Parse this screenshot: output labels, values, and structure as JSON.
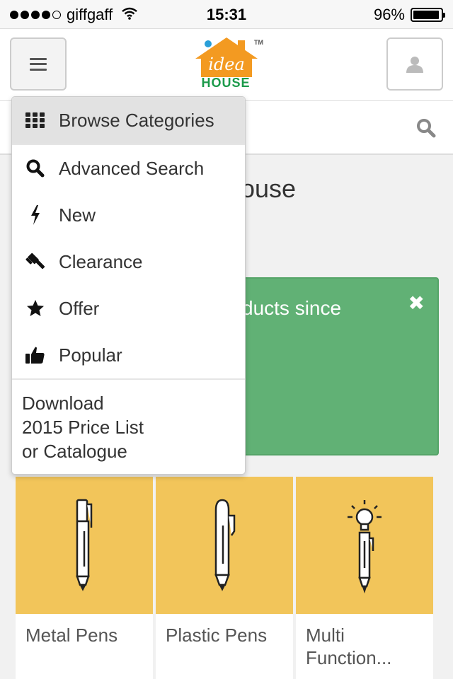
{
  "status_bar": {
    "carrier": "giffgaff",
    "time": "15:31",
    "battery_percent": "96%",
    "battery_level": 0.96
  },
  "header": {
    "logo_text": "HOUSE",
    "logo_script": "idea",
    "logo_tm": "TM",
    "menu_icon": "hamburger-icon",
    "user_icon": "user-icon"
  },
  "search": {
    "icon": "search-icon"
  },
  "page": {
    "title_partial": "ouse"
  },
  "notice": {
    "text_partial": "ducts since",
    "close_label": "✖"
  },
  "menu": {
    "items": [
      {
        "label": "Browse Categories",
        "icon": "grid-icon",
        "active": true
      },
      {
        "label": "Advanced Search",
        "icon": "search-icon"
      },
      {
        "label": "New",
        "icon": "bolt-icon"
      },
      {
        "label": "Clearance",
        "icon": "gavel-icon"
      },
      {
        "label": "Offer",
        "icon": "star-icon"
      },
      {
        "label": "Popular",
        "icon": "thumbs-up-icon"
      }
    ],
    "download_lines": [
      "Download",
      "2015 Price List",
      "or Catalogue"
    ]
  },
  "tiles": [
    {
      "label": "Metal Pens",
      "icon": "metal-pen-icon"
    },
    {
      "label": "Plastic Pens",
      "icon": "plastic-pen-icon"
    },
    {
      "label": "Multi Function...",
      "icon": "multifunction-pen-icon"
    }
  ],
  "colors": {
    "tile_bg": "#f2c55a",
    "notice_bg": "#61b175",
    "logo_orange": "#f39a21",
    "logo_green": "#1b9a4a"
  }
}
